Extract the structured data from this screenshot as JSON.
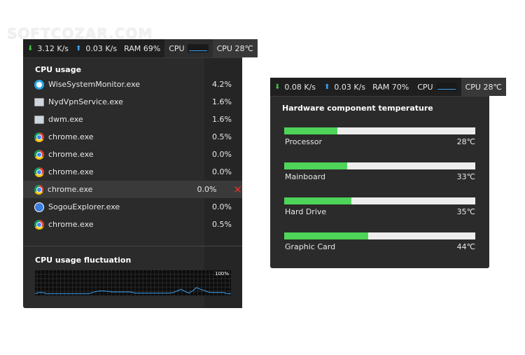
{
  "watermark": "SOFTCOZAR.COM",
  "panel1": {
    "toolbar": {
      "down": "3.12 K/s",
      "up": "0.03 K/s",
      "ram": "RAM 69%",
      "cpu": "CPU",
      "temp": "CPU 28℃"
    },
    "title": "CPU usage",
    "processes": [
      {
        "icon": "wise-icon",
        "name": "WiseSystemMonitor.exe",
        "cpu": "4.2%"
      },
      {
        "icon": "window-icon",
        "name": "NydVpnService.exe",
        "cpu": "1.6%"
      },
      {
        "icon": "window-icon",
        "name": "dwm.exe",
        "cpu": "1.6%"
      },
      {
        "icon": "chrome-icon",
        "name": "chrome.exe",
        "cpu": "0.5%"
      },
      {
        "icon": "chrome-icon",
        "name": "chrome.exe",
        "cpu": "0.0%"
      },
      {
        "icon": "chrome-icon",
        "name": "chrome.exe",
        "cpu": "0.0%"
      },
      {
        "icon": "chrome-icon",
        "name": "chrome.exe",
        "cpu": "0.0%",
        "selected": true
      },
      {
        "icon": "sogou-icon",
        "name": "SogouExplorer.exe",
        "cpu": "0.0%"
      },
      {
        "icon": "chrome-icon",
        "name": "chrome.exe",
        "cpu": "0.5%"
      }
    ],
    "fluct_title": "CPU usage fluctuation",
    "fluct_max": "100%",
    "chart_data": {
      "type": "line",
      "ylim": [
        0,
        100
      ],
      "values": [
        2,
        4,
        4,
        2,
        2,
        2,
        2,
        2,
        2,
        2,
        2,
        2,
        2,
        2,
        2,
        4,
        6,
        7,
        7,
        6,
        5,
        5,
        5,
        5,
        5,
        5,
        3,
        3,
        3,
        3,
        3,
        3,
        3,
        3,
        3,
        3,
        4,
        7,
        10,
        6,
        3,
        7,
        13,
        10,
        8,
        5,
        4,
        4,
        4,
        4,
        2,
        2
      ]
    },
    "colors": {
      "line": "#3aa0f0",
      "accent_close": "#e03030"
    }
  },
  "panel2": {
    "toolbar": {
      "down": "0.08 K/s",
      "up": "0.03 K/s",
      "ram": "RAM 70%",
      "cpu": "CPU",
      "temp": "CPU 28℃"
    },
    "title": "Hardware component temperature",
    "components": [
      {
        "name": "Processor",
        "temp": "28℃",
        "level": 28
      },
      {
        "name": "Mainboard",
        "temp": "33℃",
        "level": 33
      },
      {
        "name": "Hard Drive",
        "temp": "35℃",
        "level": 35
      },
      {
        "name": "Graphic Card",
        "temp": "44℃",
        "level": 44
      }
    ],
    "colors": {
      "bar_fill": "#4fd45a",
      "bar_track": "#ededed"
    }
  }
}
